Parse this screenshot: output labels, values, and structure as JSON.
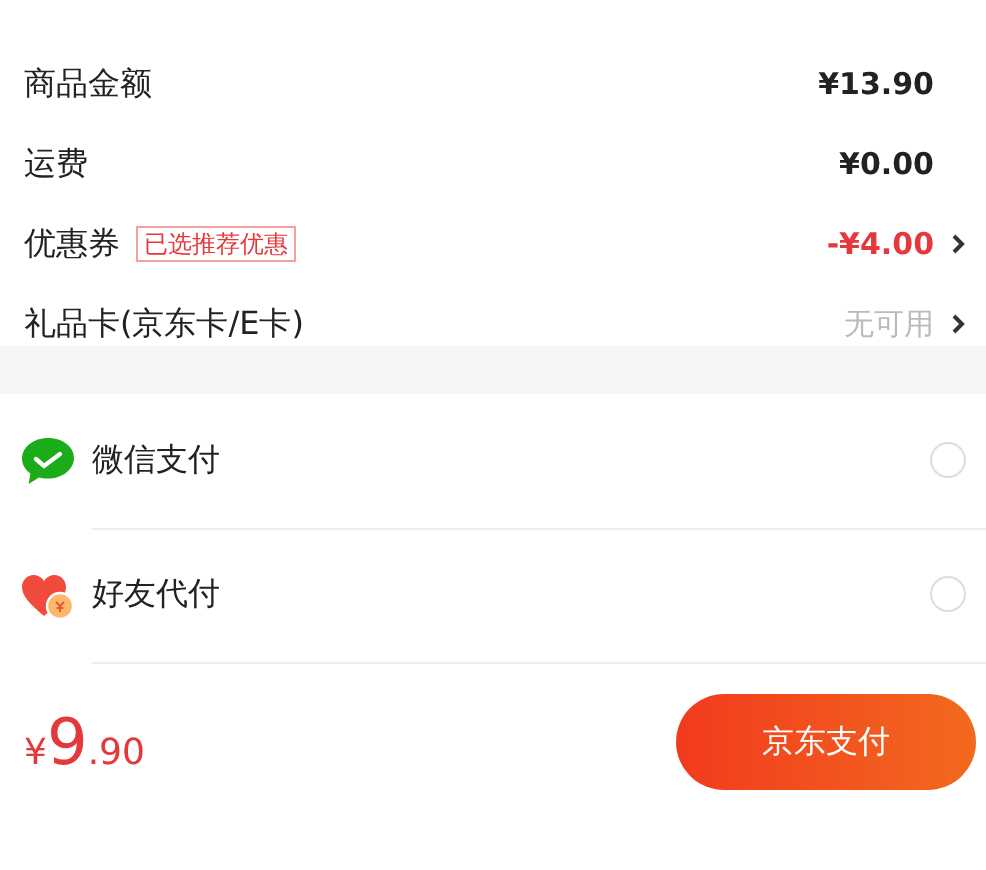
{
  "summary_rows": [
    {
      "label": "商品金额",
      "value": "¥13.90",
      "kind": "plain",
      "arrow": false
    },
    {
      "label": "运费",
      "value": "¥0.00",
      "kind": "plain",
      "arrow": false
    },
    {
      "label": "优惠券",
      "tag": "已选推荐优惠",
      "value": "-¥4.00",
      "kind": "discount",
      "arrow": true
    },
    {
      "label": "礼品卡(京东卡/E卡)",
      "value": "无可用",
      "kind": "muted",
      "arrow": true
    }
  ],
  "payment_methods": [
    {
      "label": "微信支付",
      "kind": "wechat",
      "selected": false
    },
    {
      "label": "好友代付",
      "kind": "friend",
      "selected": false
    }
  ],
  "total": {
    "currency": "¥",
    "integer": "9",
    "decimal": ".90"
  },
  "pay_button": {
    "label": "京东支付"
  }
}
